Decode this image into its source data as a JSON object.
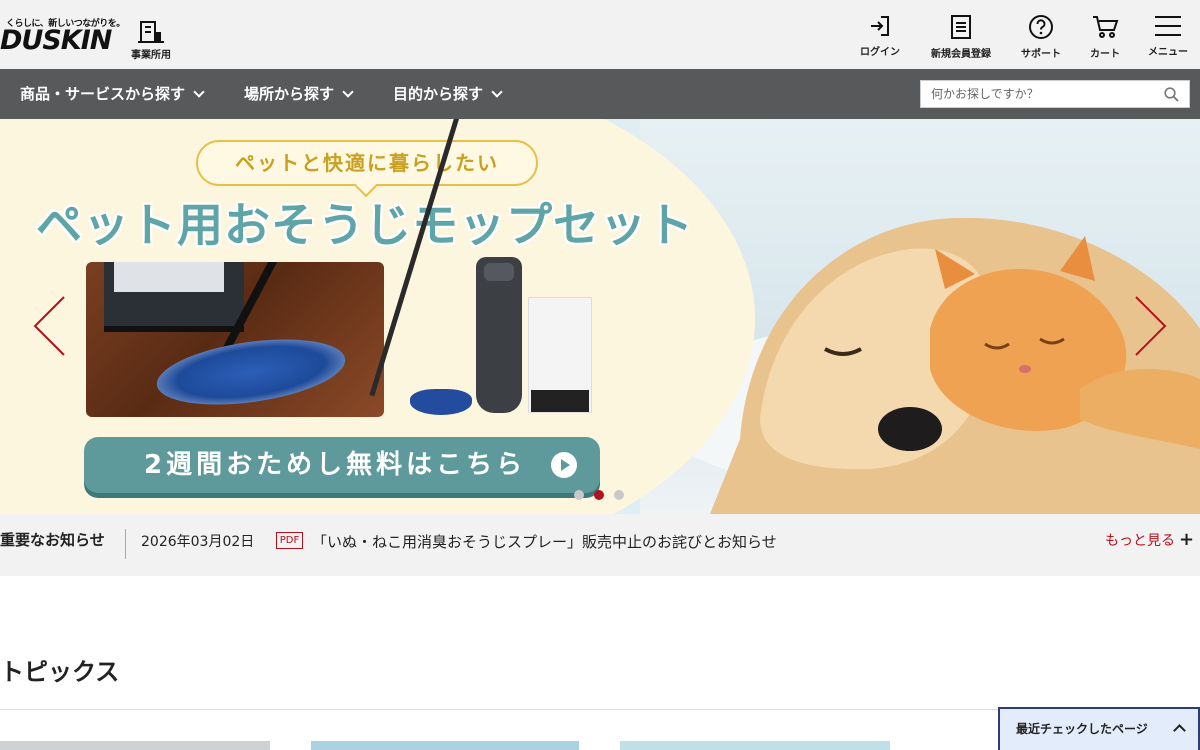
{
  "brand": {
    "tagline": "くらしに、新しいつながりを。",
    "logo": "DUSKIN",
    "business_label": "事業所用"
  },
  "header_nav": [
    {
      "label": "ログイン",
      "icon": "login-icon"
    },
    {
      "label": "新規会員登録",
      "icon": "register-icon"
    },
    {
      "label": "サポート",
      "icon": "help-icon"
    },
    {
      "label": "カート",
      "icon": "cart-icon"
    },
    {
      "label": "メニュー",
      "icon": "menu-icon"
    }
  ],
  "nav": {
    "items": [
      {
        "label": "商品・サービスから探す"
      },
      {
        "label": "場所から探す"
      },
      {
        "label": "目的から探す"
      }
    ],
    "search_placeholder": "何かお探しですか？"
  },
  "hero": {
    "bubble": "ペットと快適に暮らしたい",
    "title": "ペット用おそうじモップセット",
    "cta": "2週間おためし無料はこちら",
    "slides": 3,
    "active_slide": 2
  },
  "notice": {
    "title": "重要なお知らせ",
    "date": "2026年03月02日",
    "badge": "PDF",
    "text": "「いぬ・ねこ用消臭おそうじスプレー」販売中止のお詫びとお知らせ",
    "more": "もっと見る"
  },
  "topics": {
    "title": "トピックス"
  },
  "recent": {
    "label": "最近チェックしたページ"
  },
  "colors": {
    "accent": "#b3111d",
    "nav_bg": "#58595b",
    "header_bg": "#f2f2f2",
    "recent_bg": "#e3ecfb"
  }
}
